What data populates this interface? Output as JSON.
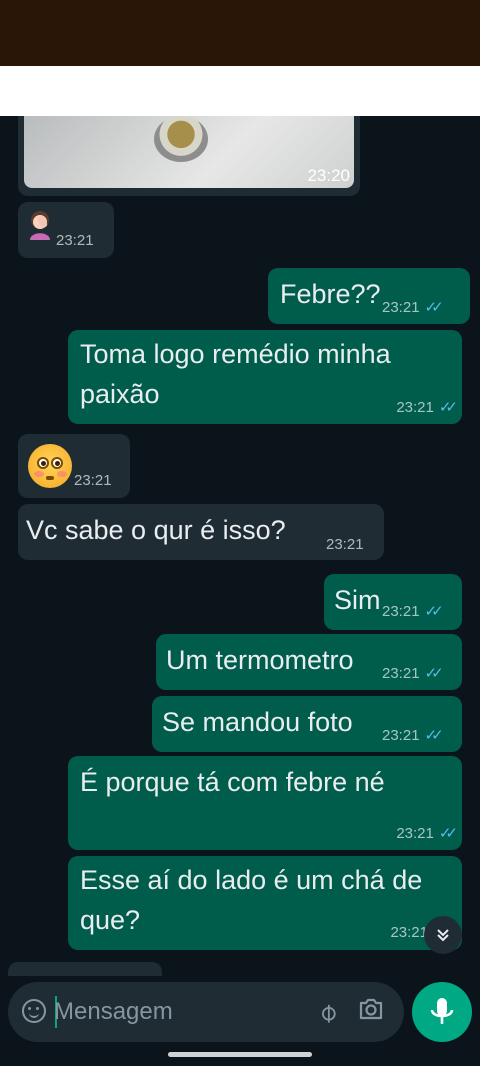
{
  "messages": [
    {
      "id": "m0",
      "type": "photo",
      "dir": "in",
      "time": "23:20"
    },
    {
      "id": "m1",
      "type": "emoji",
      "dir": "in",
      "emoji": "person-facepalming",
      "time": "23:21"
    },
    {
      "id": "m2",
      "type": "text",
      "dir": "out",
      "text": "Febre??",
      "time": "23:21"
    },
    {
      "id": "m3",
      "type": "text",
      "dir": "out",
      "text": "Toma logo remédio minha paixão",
      "time": "23:21"
    },
    {
      "id": "m4",
      "type": "emoji",
      "dir": "in",
      "emoji": "flushed-face",
      "time": "23:21"
    },
    {
      "id": "m5",
      "type": "text",
      "dir": "in",
      "text": "Vc sabe o qur é isso?",
      "time": "23:21"
    },
    {
      "id": "m6",
      "type": "text",
      "dir": "out",
      "text": "Sim",
      "time": "23:21"
    },
    {
      "id": "m7",
      "type": "text",
      "dir": "out",
      "text": "Um termometro",
      "time": "23:21"
    },
    {
      "id": "m8",
      "type": "text",
      "dir": "out",
      "text": "Se mandou foto",
      "time": "23:21"
    },
    {
      "id": "m9",
      "type": "text",
      "dir": "out",
      "text": "É porque tá com febre né",
      "time": "23:21"
    },
    {
      "id": "m10",
      "type": "text",
      "dir": "out",
      "text": "Esse aí do lado é um chá de que?",
      "time": "23:21"
    }
  ],
  "composer": {
    "placeholder": "Mensagem"
  },
  "icons": {
    "read_receipt": "double-check-blue",
    "scroll_down": "chevron-double-down",
    "emoji": "emoji-smile",
    "attach": "paperclip",
    "camera": "camera",
    "mic": "microphone"
  },
  "colors": {
    "background": "#0b141a",
    "incoming_bubble": "#202c33",
    "outgoing_bubble": "#005c4b",
    "accent": "#00a884",
    "read_tick": "#53bdeb"
  }
}
